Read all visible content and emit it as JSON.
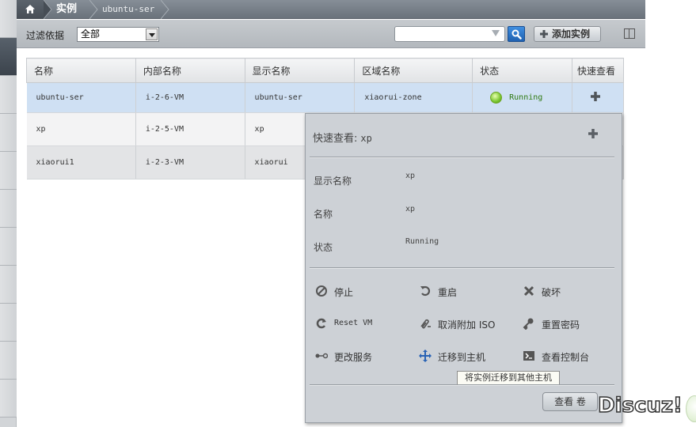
{
  "breadcrumb": {
    "section": "实例",
    "current": "ubuntu-ser"
  },
  "filter": {
    "label": "过滤依据",
    "selected": "全部"
  },
  "search": {
    "value": "",
    "placeholder": ""
  },
  "toolbar": {
    "add_instance_label": "添加实例"
  },
  "table": {
    "headers": [
      "名称",
      "内部名称",
      "显示名称",
      "区域名称",
      "状态",
      "快速查看"
    ],
    "rows": [
      [
        "ubuntu-ser",
        "i-2-6-VM",
        "ubuntu-ser",
        "xiaorui-zone",
        "Running"
      ],
      [
        "xp",
        "i-2-5-VM",
        "xp",
        "",
        ""
      ],
      [
        "xiaorui1",
        "i-2-3-VM",
        "xiaorui",
        "",
        ""
      ]
    ]
  },
  "quickview": {
    "title": "快速查看:",
    "title_value": "xp",
    "fields": [
      {
        "label": "显示名称",
        "value": "xp"
      },
      {
        "label": "名称",
        "value": "xp"
      },
      {
        "label": "状态",
        "value": "Running"
      }
    ],
    "actions": {
      "stop": "停止",
      "reboot": "重启",
      "destroy": "破坏",
      "reset_vm": "Reset VM",
      "detach_iso": "取消附加 ISO",
      "reset_password": "重置密码",
      "change_service": "更改服务",
      "migrate": "迁移到主机",
      "view_console": "查看控制台"
    },
    "migrate_tooltip": "将实例迁移到其他主机",
    "view_volumes_label": "查看 卷"
  },
  "watermark": "Discuz!",
  "colors": {
    "running_green": "#2f7a12",
    "selected_row": "#cfe0f3",
    "search_blue": "#2a73c6"
  }
}
